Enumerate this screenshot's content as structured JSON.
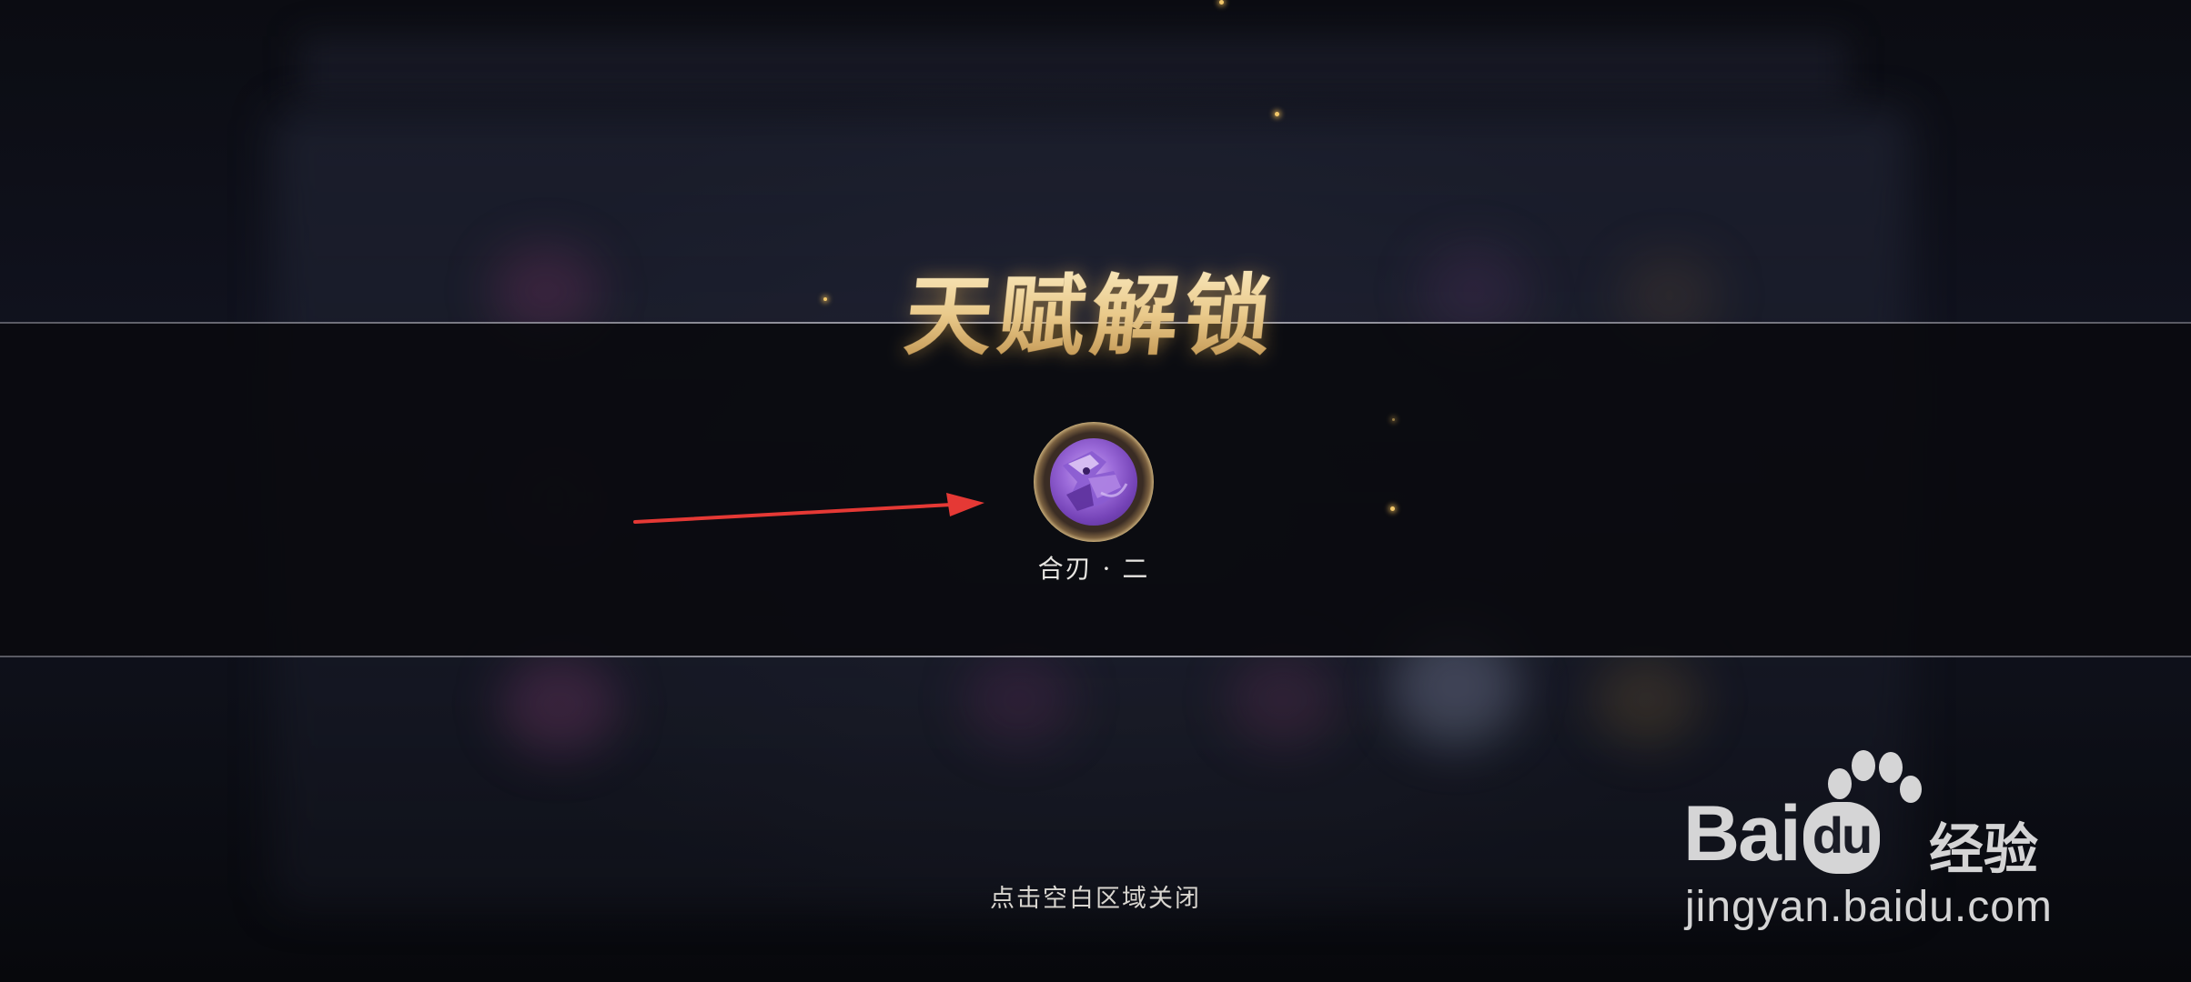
{
  "popup": {
    "title": "天赋解锁",
    "talent": {
      "name": "合刃 · 二",
      "icon": "talent-blade-icon"
    },
    "close_hint": "点击空白区域关闭"
  },
  "annotation": {
    "arrow_icon": "red-arrow-icon",
    "arrow_color": "#e53935"
  },
  "watermark": {
    "brand_prefix": "Bai",
    "brand_du": "du",
    "brand_cn": "经验",
    "url": "jingyan.baidu.com",
    "icon": "baidu-paw-icon"
  },
  "colors": {
    "title_gold": "#e9c98a",
    "talent_purple": "#9b6ad9",
    "band_line": "#c8c8d2"
  }
}
